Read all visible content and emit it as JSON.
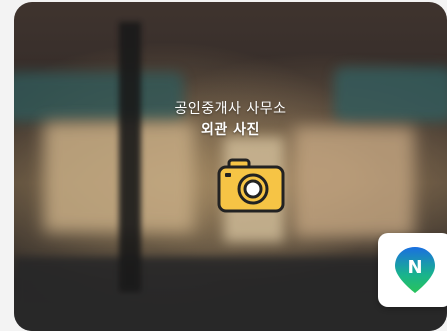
{
  "photo": {
    "title": "공인중개사 사무소",
    "subtitle": "외관 사진"
  },
  "icons": {
    "camera": "camera-icon",
    "navi": "naver-map-icon"
  },
  "colors": {
    "camera_fill": "#f6c445",
    "navi_green": "#29c35b",
    "navi_blue": "#1a6fe0"
  },
  "navi": {
    "letter": "N"
  }
}
